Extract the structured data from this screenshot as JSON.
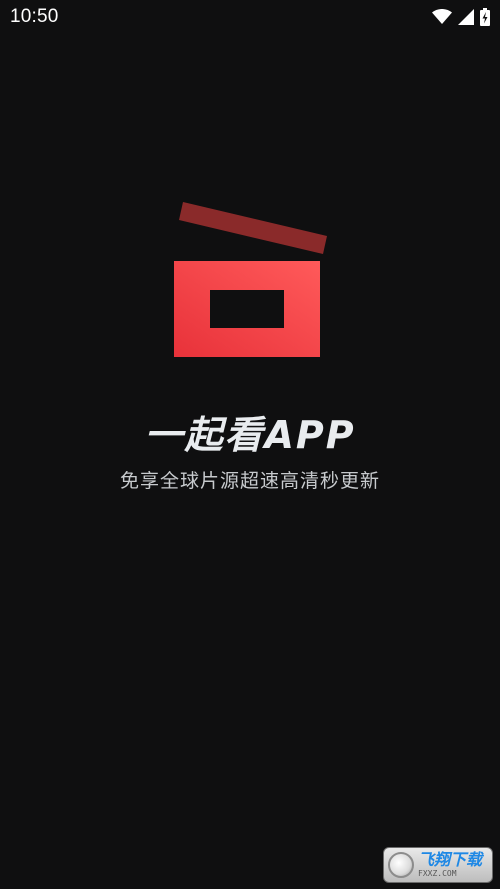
{
  "status_bar": {
    "time": "10:50",
    "icons": [
      "wifi-icon",
      "cellular-signal-icon",
      "battery-charging-icon"
    ]
  },
  "splash": {
    "logo_icon": "clapperboard-icon",
    "title": "一起看APP",
    "tagline": "免享全球片源超速高清秒更新"
  },
  "watermark": {
    "name": "飞翔下载",
    "url": "FXXZ.COM"
  },
  "colors": {
    "background": "#0f0f10",
    "logo_red": "#f0383e",
    "logo_dark_red": "#8a2a2a",
    "title": "#e9ecef",
    "tagline": "#c7cacd"
  }
}
